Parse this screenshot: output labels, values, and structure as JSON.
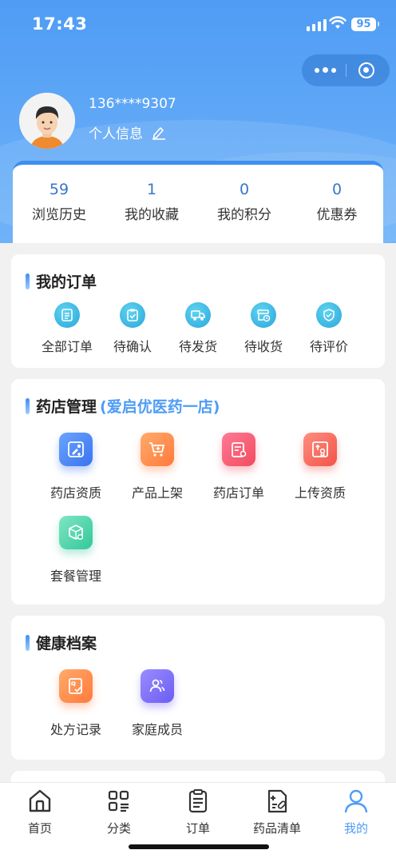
{
  "status_bar": {
    "time": "17:43",
    "battery": "95"
  },
  "user": {
    "phone": "136****9307",
    "profile_link": "个人信息"
  },
  "stats": [
    {
      "value": "59",
      "label": "浏览历史"
    },
    {
      "value": "1",
      "label": "我的收藏"
    },
    {
      "value": "0",
      "label": "我的积分"
    },
    {
      "value": "0",
      "label": "优惠券"
    }
  ],
  "orders": {
    "title": "我的订单",
    "items": [
      {
        "label": "全部订单",
        "icon": "list-doc-icon"
      },
      {
        "label": "待确认",
        "icon": "clipboard-check-icon"
      },
      {
        "label": "待发货",
        "icon": "truck-icon"
      },
      {
        "label": "待收货",
        "icon": "box-clock-icon"
      },
      {
        "label": "待评价",
        "icon": "shield-review-icon"
      }
    ]
  },
  "pharmacy": {
    "title": "药店管理",
    "store_name": "(爱启优医药一店)",
    "items": [
      {
        "label": "药店资质",
        "icon": "license-icon",
        "color": "#3b73ee"
      },
      {
        "label": "产品上架",
        "icon": "cart-add-icon",
        "color": "#ff7a3c"
      },
      {
        "label": "药店订单",
        "icon": "order-gear-icon",
        "color": "#f24b5e"
      },
      {
        "label": "上传资质",
        "icon": "upload-cert-icon",
        "color": "#f25448"
      },
      {
        "label": "套餐管理",
        "icon": "package-gear-icon",
        "color": "#34c79a"
      }
    ]
  },
  "health": {
    "title": "健康档案",
    "items": [
      {
        "label": "处方记录",
        "icon": "rx-record-icon",
        "color": "#ff7a3c"
      },
      {
        "label": "家庭成员",
        "icon": "family-icon",
        "color": "#6a5df2"
      }
    ]
  },
  "tabbar": [
    {
      "label": "首页",
      "icon": "home-icon"
    },
    {
      "label": "分类",
      "icon": "category-icon"
    },
    {
      "label": "订单",
      "icon": "order-icon"
    },
    {
      "label": "药品清单",
      "icon": "drug-list-icon"
    },
    {
      "label": "我的",
      "icon": "profile-icon",
      "active": true
    }
  ],
  "colors": {
    "accent": "#4f9cf5",
    "stat_value": "#3976c8"
  }
}
